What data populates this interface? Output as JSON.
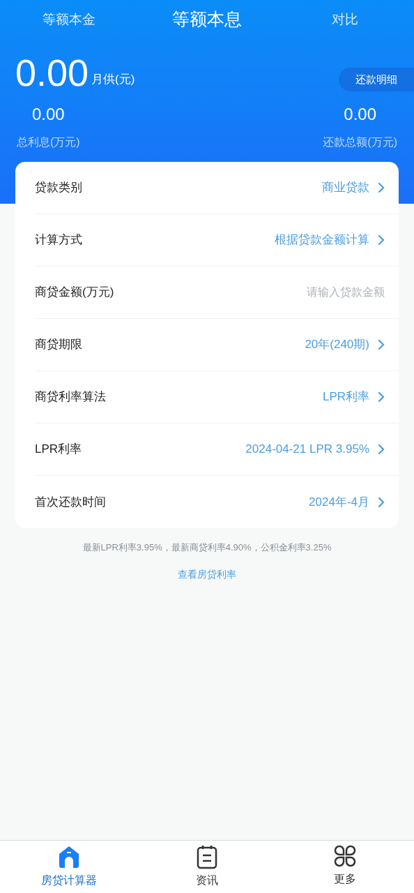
{
  "tabs": [
    {
      "label": "等额本金",
      "selected": false
    },
    {
      "label": "等额本息",
      "selected": true
    },
    {
      "label": "对比",
      "selected": false
    }
  ],
  "summary": {
    "monthly": {
      "value": "0.00",
      "unit": "月供(元)"
    },
    "detail_button": "还款明细",
    "interest": {
      "value": "0.00",
      "label": "总利息(万元)"
    },
    "total": {
      "value": "0.00",
      "label": "还款总额(万元)"
    }
  },
  "form": [
    {
      "kind": "select",
      "label": "贷款类别",
      "value": "商业贷款"
    },
    {
      "kind": "select",
      "label": "计算方式",
      "value": "根据贷款金额计算"
    },
    {
      "kind": "input",
      "label": "商贷金额(万元)",
      "placeholder": "请输入贷款金额"
    },
    {
      "kind": "select",
      "label": "商贷期限",
      "value": "20年(240期)"
    },
    {
      "kind": "select",
      "label": "商贷利率算法",
      "value": "LPR利率"
    },
    {
      "kind": "select",
      "label": "LPR利率",
      "value": "2024-04-21 LPR 3.95%"
    },
    {
      "kind": "select",
      "label": "首次还款时间",
      "value": "2024年-4月"
    }
  ],
  "rate_note": "最新LPR利率3.95%，最新商贷利率4.90%，公积金利率3.25%",
  "rate_link": "查看房贷利率",
  "bottom_nav": [
    {
      "kind": "home",
      "label": "房贷计算器",
      "selected": true
    },
    {
      "kind": "news",
      "label": "资讯",
      "selected": false
    },
    {
      "kind": "more",
      "label": "更多",
      "selected": false
    }
  ]
}
